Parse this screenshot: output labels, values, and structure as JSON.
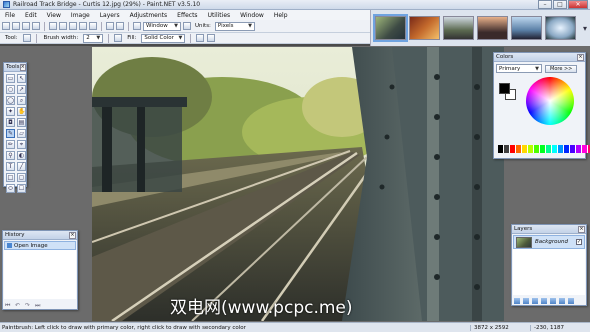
{
  "window": {
    "title": "Railroad Track Bridge - Curtis 12.jpg (29%) - Paint.NET v3.5.10",
    "min": "–",
    "max": "□",
    "close": "✕"
  },
  "menu": [
    "File",
    "Edit",
    "View",
    "Image",
    "Layers",
    "Adjustments",
    "Effects",
    "Utilities",
    "Window",
    "Help"
  ],
  "toolbar": {
    "zoom_value": "Window",
    "units_label": "Units:",
    "units_value": "Pixels"
  },
  "tool_options": {
    "tool_label": "Tool:",
    "brush_width_label": "Brush width:",
    "brush_width_value": "2",
    "fill_label": "Fill:",
    "fill_value": "Solid Color"
  },
  "panels": {
    "tools_title": "Tools",
    "history_title": "History",
    "history_items": [
      "Open Image"
    ],
    "colors_title": "Colors",
    "colors_mode": "Primary",
    "colors_more": "More >>",
    "layers_title": "Layers",
    "layer_items": [
      "Background"
    ]
  },
  "colors": {
    "palette": [
      "#000000",
      "#404040",
      "#ff0000",
      "#ff6a00",
      "#ffd800",
      "#b6ff00",
      "#4cff00",
      "#00ff21",
      "#00ff90",
      "#00ffff",
      "#0094ff",
      "#0026ff",
      "#4800ff",
      "#b200ff",
      "#ff00dc",
      "#ff006e"
    ],
    "accent": "#6fa3e0"
  },
  "status": {
    "tip": "Paintbrush: Left click to draw with primary color, right click to draw with secondary color",
    "image_size": "3872 x 2592",
    "cursor": "-230, 1187"
  },
  "watermark": "双电网(www.pcpc.me)"
}
